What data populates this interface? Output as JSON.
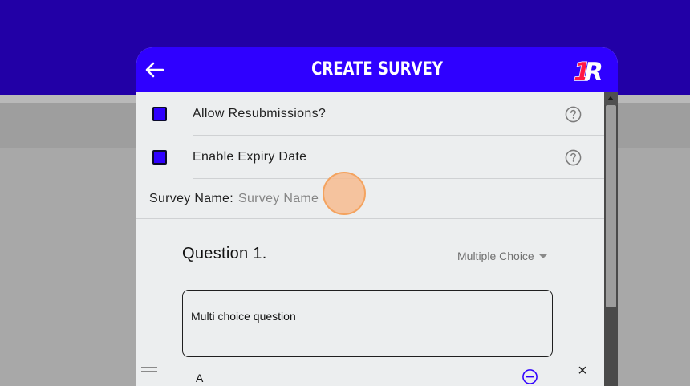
{
  "colors": {
    "background_header": "#2200a6",
    "modal_header": "#2f00ff",
    "modal_body": "#eceeef",
    "checkbox_fill": "#2f00ff",
    "click_indicator": "#f6ba8c"
  },
  "modal": {
    "title": "CREATE SURVEY",
    "back_icon": "arrow-left-icon",
    "logo_text": "1R"
  },
  "settings": [
    {
      "label": "Allow Resubmissions?",
      "checked": true,
      "help_icon": "question-circle-icon"
    },
    {
      "label": "Enable Expiry Date",
      "checked": true,
      "help_icon": "question-circle-icon"
    }
  ],
  "survey_name": {
    "label": "Survey Name:",
    "placeholder": "Survey Name",
    "value": ""
  },
  "question": {
    "title": "Question 1.",
    "type": "Multiple Choice",
    "text": "Multi choice question",
    "options": [
      {
        "label": "A",
        "remove_icon": "minus-circle-icon",
        "delete_icon": "close-icon",
        "delete_glyph": "×"
      }
    ]
  }
}
